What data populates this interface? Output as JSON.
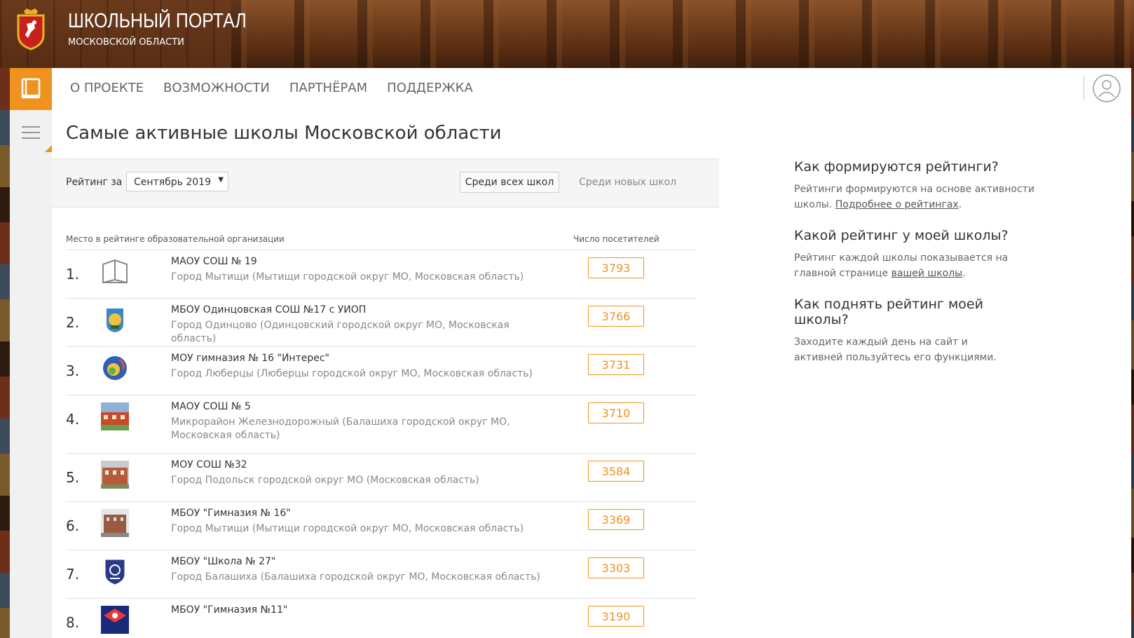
{
  "header": {
    "portal_title": "ШКОЛЬНЫЙ ПОРТАЛ",
    "portal_subtitle": "МОСКОВСКОЙ ОБЛАСТИ",
    "crest_icon": "moscow-oblast-crest-icon"
  },
  "nav": {
    "items": [
      "О ПРОЕКТЕ",
      "ВОЗМОЖНОСТИ",
      "ПАРТНЁРАМ",
      "ПОДДЕРЖКА"
    ]
  },
  "page": {
    "title": "Самые активные школы Московской области"
  },
  "filter": {
    "label": "Рейтинг за",
    "month": "Сентябрь 2019",
    "btn_all": "Среди всех школ",
    "btn_new": "Среди новых школ"
  },
  "table": {
    "col_place": "Место в рейтинге образовательной организации",
    "col_visitors": "Число посетителей",
    "rows": [
      {
        "num": "1.",
        "name": "МАОУ СОШ № 19",
        "addr": "Город Мытищи (Мытищи городской округ МО, Московская область)",
        "count": "3793"
      },
      {
        "num": "2.",
        "name": "МБОУ Одинцовская СОШ №17 с УИОП",
        "addr": "Город Одинцово (Одинцовский городской округ МО, Московская область)",
        "count": "3766"
      },
      {
        "num": "3.",
        "name": "МОУ гимназия № 16 \"Интерес\"",
        "addr": "Город Люберцы (Люберцы городской округ МО, Московская область)",
        "count": "3731"
      },
      {
        "num": "4.",
        "name": "МАОУ СОШ № 5",
        "addr": "Микрорайон Железнодорожный (Балашиха городской округ МО, Московская область)",
        "count": "3710"
      },
      {
        "num": "5.",
        "name": "МОУ СОШ №32",
        "addr": "Город Подольск городской округ МО (Московская область)",
        "count": "3584"
      },
      {
        "num": "6.",
        "name": "МБОУ \"Гимназия № 16\"",
        "addr": "Город Мытищи (Мытищи городской округ МО, Московская область)",
        "count": "3369"
      },
      {
        "num": "7.",
        "name": "МБОУ \"Школа № 27\"",
        "addr": "Город Балашиха (Балашиха городской округ МО, Московская область)",
        "count": "3303"
      },
      {
        "num": "8.",
        "name": "МБОУ \"Гимназия №11\"",
        "addr": "",
        "count": "3190"
      }
    ]
  },
  "sidebar_info": {
    "q1_title": "Как формируются рейтинги?",
    "q1_text": "Рейтинги формируются на основе активности школы.",
    "q1_link": "Подробнее о рейтингах",
    "q2_title": "Какой рейтинг у моей школы?",
    "q2_text": "Рейтинг каждой школы показывается на главной странице",
    "q2_link": "вашей школы",
    "q3_title": "Как поднять рейтинг моей школы?",
    "q3_text": "Заходите каждый день на сайт и активней пользуйтесь его функциями."
  },
  "colors": {
    "accent": "#f0921e"
  }
}
